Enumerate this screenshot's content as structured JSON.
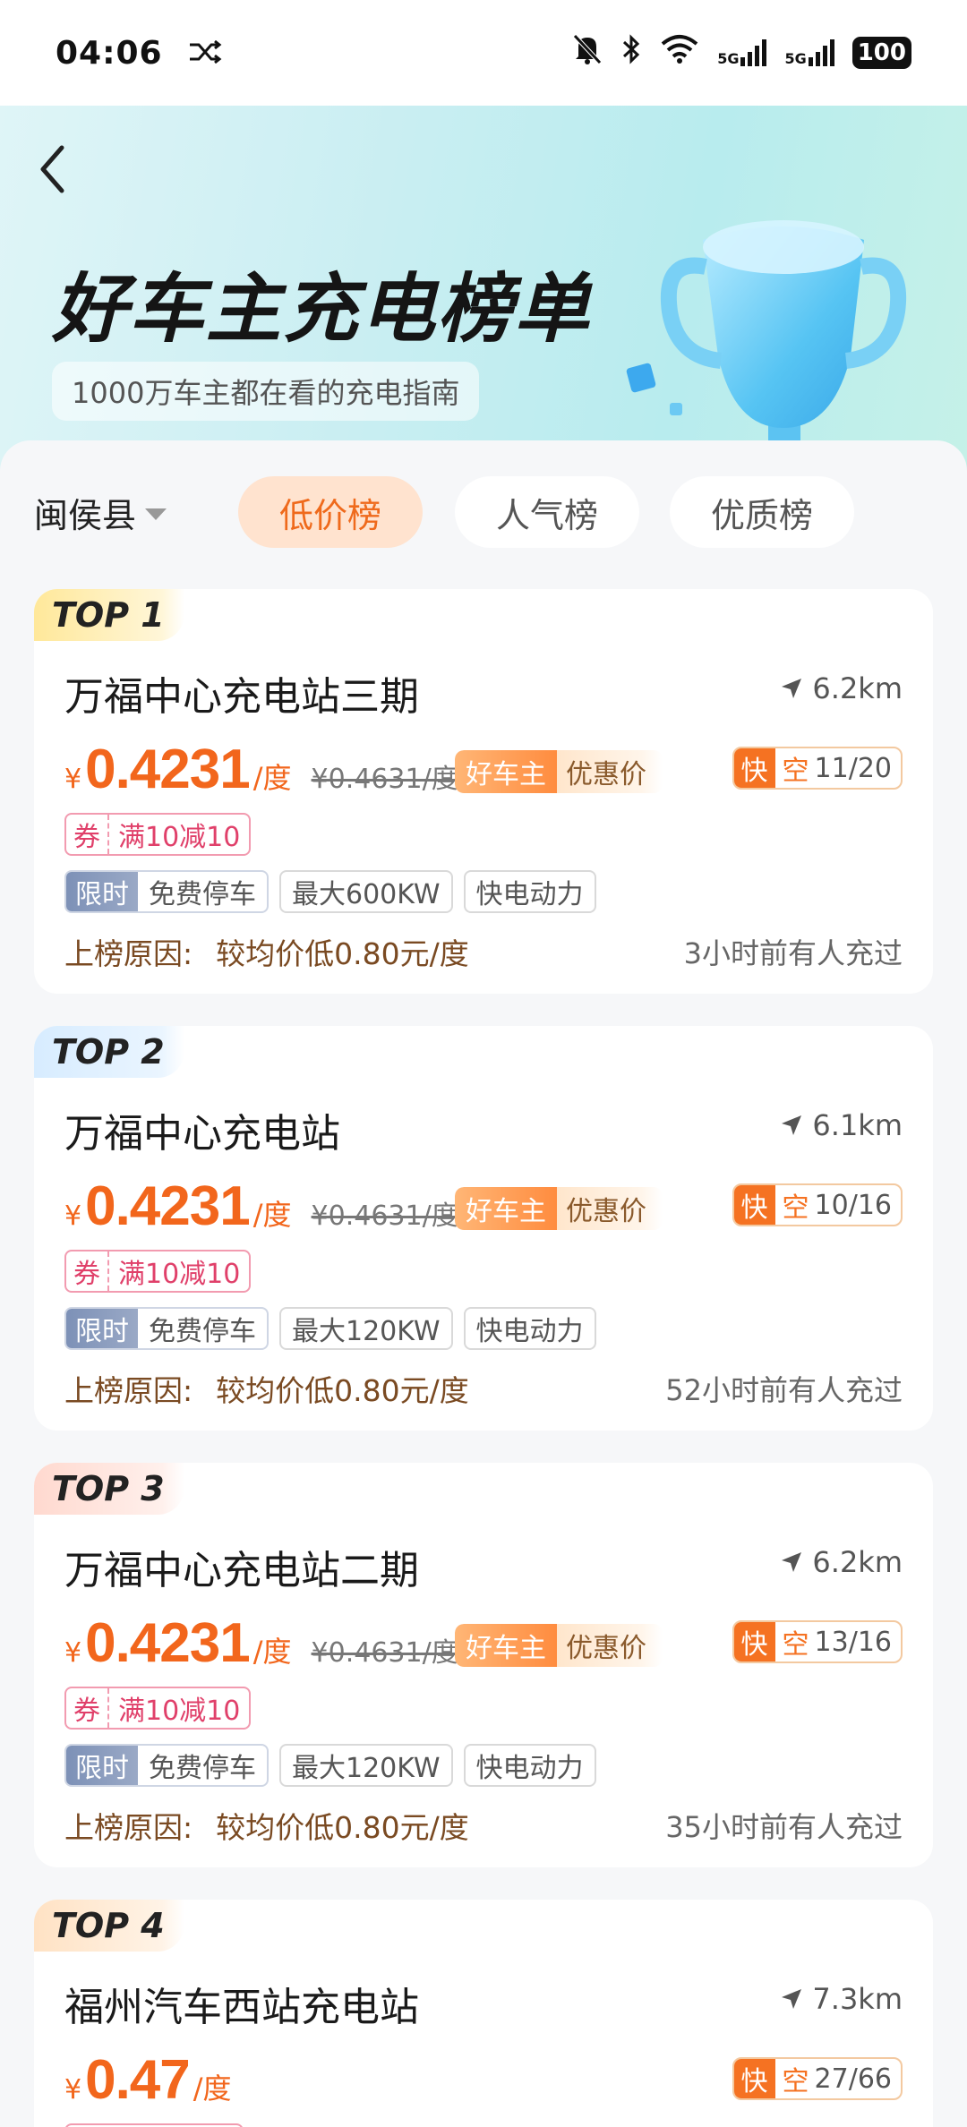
{
  "status": {
    "time": "04:06",
    "battery": "100",
    "sim1": "5G",
    "sim2": "5G"
  },
  "header": {
    "title": "好车主充电榜单",
    "subtitle": "1000万车主都在看的充电指南"
  },
  "filters": {
    "region": "闽侯县",
    "tabs": [
      "低价榜",
      "人气榜",
      "优质榜"
    ],
    "active_tab": "低价榜"
  },
  "labels": {
    "good_owner": "好车主",
    "discount_price": "优惠价",
    "fast": "快",
    "free": "空",
    "coupon_key": "券",
    "limited": "限时",
    "reason_key": "上榜原因:",
    "yen": "¥",
    "per_unit": "/度"
  },
  "stations": [
    {
      "rank": "TOP 1",
      "name": "万福中心充电站三期",
      "distance": "6.2km",
      "price": "0.4231",
      "original_price": "¥0.4631/度",
      "slots": "11/20",
      "coupon": "满10减10",
      "free_parking": "免费停车",
      "max_power": "最大600KW",
      "provider": "快电动力",
      "reason": "较均价低0.80元/度",
      "recent": "3小时前有人充过"
    },
    {
      "rank": "TOP 2",
      "name": "万福中心充电站",
      "distance": "6.1km",
      "price": "0.4231",
      "original_price": "¥0.4631/度",
      "slots": "10/16",
      "coupon": "满10减10",
      "free_parking": "免费停车",
      "max_power": "最大120KW",
      "provider": "快电动力",
      "reason": "较均价低0.80元/度",
      "recent": "52小时前有人充过"
    },
    {
      "rank": "TOP 3",
      "name": "万福中心充电站二期",
      "distance": "6.2km",
      "price": "0.4231",
      "original_price": "¥0.4631/度",
      "slots": "13/16",
      "coupon": "满10减10",
      "free_parking": "免费停车",
      "max_power": "最大120KW",
      "provider": "快电动力",
      "reason": "较均价低0.80元/度",
      "recent": "35小时前有人充过"
    },
    {
      "rank": "TOP 4",
      "name": "福州汽车西站充电站",
      "distance": "7.3km",
      "price": "0.47",
      "slots": "27/66"
    }
  ],
  "colors": {
    "accent": "#f2661c",
    "tab_active_bg": "#ffe3cf",
    "coupon": "#e0406a",
    "reason": "#7a4a22"
  }
}
